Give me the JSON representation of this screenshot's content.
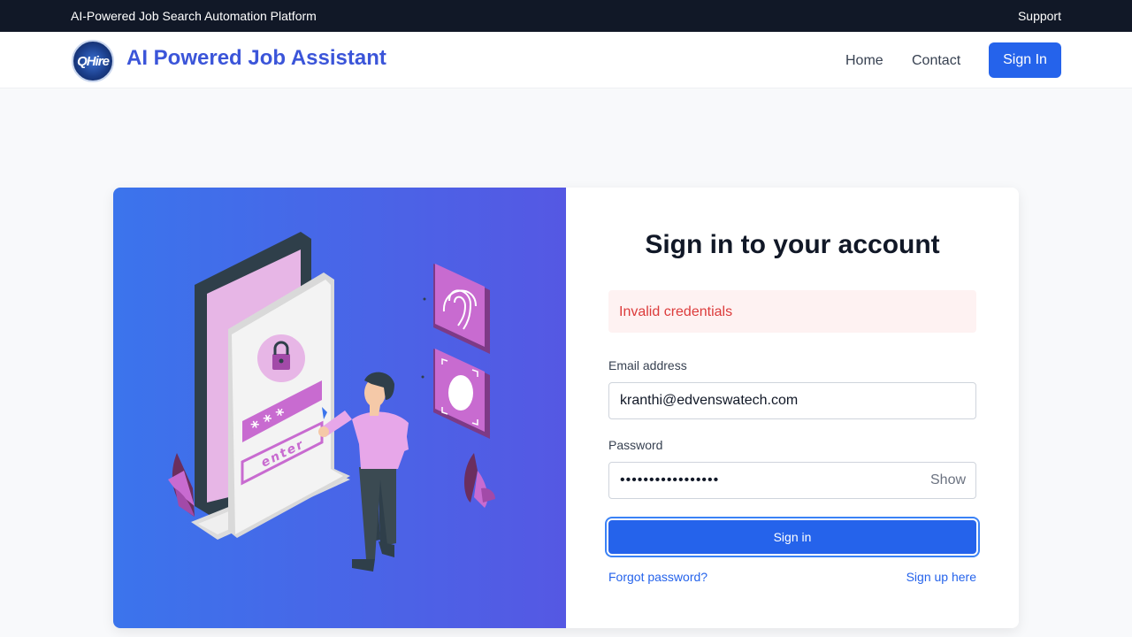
{
  "topbar": {
    "tagline": "AI-Powered Job Search Automation Platform",
    "support": "Support"
  },
  "nav": {
    "logo_text": "QHire",
    "brand": "AI Powered Job Assistant",
    "links": [
      {
        "label": "Home"
      },
      {
        "label": "Contact"
      }
    ],
    "signin_label": "Sign In"
  },
  "illustration": {
    "enter_text": "enter",
    "password_mask": "* * *"
  },
  "form": {
    "title": "Sign in to your account",
    "error": "Invalid credentials",
    "email_label": "Email address",
    "email_value": "kranthi@edvenswatech.com",
    "password_label": "Password",
    "password_value": "•••••••••••••••••",
    "show_label": "Show",
    "submit_label": "Sign in",
    "forgot_label": "Forgot password?",
    "signup_label": "Sign up here"
  },
  "colors": {
    "primary": "#2563eb",
    "brand": "#3b55d9",
    "error": "#dc3b3b",
    "topbar": "#111827",
    "accent_purple": "#c86bd0"
  }
}
